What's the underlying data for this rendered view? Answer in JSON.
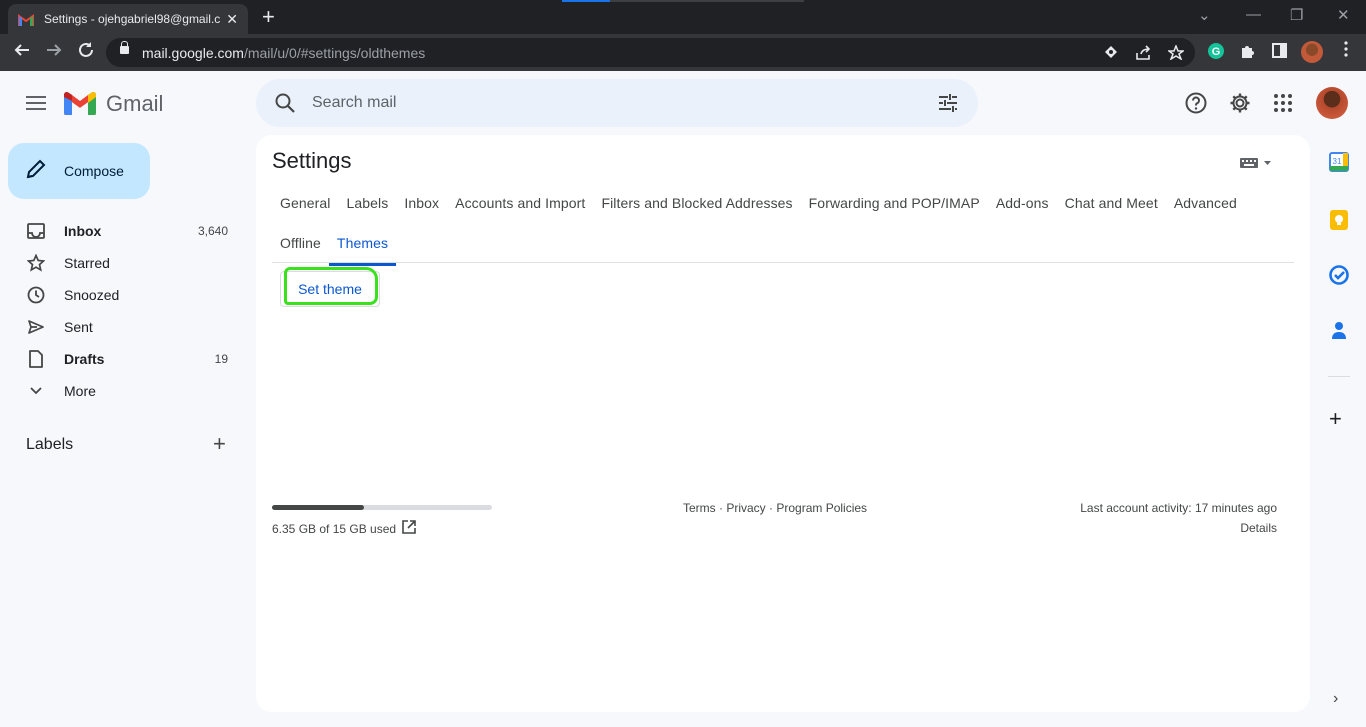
{
  "browser": {
    "tab_title": "Settings - ojehgabriel98@gmail.c",
    "tab_close": "✕",
    "new_tab": "+",
    "url_host": "mail.google.com",
    "url_path": "/mail/u/0/#settings/oldthemes",
    "window_controls": [
      "⌄",
      "—",
      "❐",
      "✕"
    ],
    "extensions": [
      "eye-icon",
      "share-icon",
      "star-icon",
      "grammarly-icon",
      "puzzle-icon",
      "sidepanel-icon"
    ]
  },
  "header": {
    "app_name": "Gmail",
    "search_placeholder": "Search mail",
    "icons": [
      "help-icon",
      "settings-icon",
      "apps-icon"
    ]
  },
  "nav": {
    "compose_label": "Compose",
    "items": [
      {
        "label": "Inbox",
        "count": "3,640",
        "icon": "inbox-icon"
      },
      {
        "label": "Starred",
        "count": "",
        "icon": "star-icon"
      },
      {
        "label": "Snoozed",
        "count": "",
        "icon": "clock-icon"
      },
      {
        "label": "Sent",
        "count": "",
        "icon": "send-icon"
      },
      {
        "label": "Drafts",
        "count": "19",
        "icon": "draft-icon"
      },
      {
        "label": "More",
        "count": "",
        "icon": "chevron-down-icon"
      }
    ],
    "labels_heading": "Labels",
    "labels_add": "+"
  },
  "settings": {
    "title": "Settings",
    "tabs_row1": [
      "General",
      "Labels",
      "Inbox",
      "Accounts and Import",
      "Filters and Blocked Addresses",
      "Forwarding and POP/IMAP",
      "Add-ons",
      "Chat and Meet",
      "Advanced"
    ],
    "tabs_row2": [
      "Offline",
      "Themes"
    ],
    "active_tab": "Themes",
    "set_theme_label": "Set theme",
    "highlight_color": "#39e21c"
  },
  "footer": {
    "storage_used_fraction": 0.42,
    "storage_text": "6.35 GB of 15 GB used",
    "terms": "Terms",
    "sep": " · ",
    "privacy": "Privacy",
    "policies": "Program Policies",
    "last_activity": "Last account activity: 17 minutes ago",
    "details": "Details"
  },
  "side_panel": {
    "icons": [
      "calendar-icon",
      "keep-icon",
      "tasks-icon",
      "contacts-icon"
    ],
    "add": "+",
    "expand": "›"
  },
  "colors": {
    "accent": "#0b57d0",
    "compose_bg": "#c2e7ff",
    "search_bg": "#eaf1fb"
  }
}
